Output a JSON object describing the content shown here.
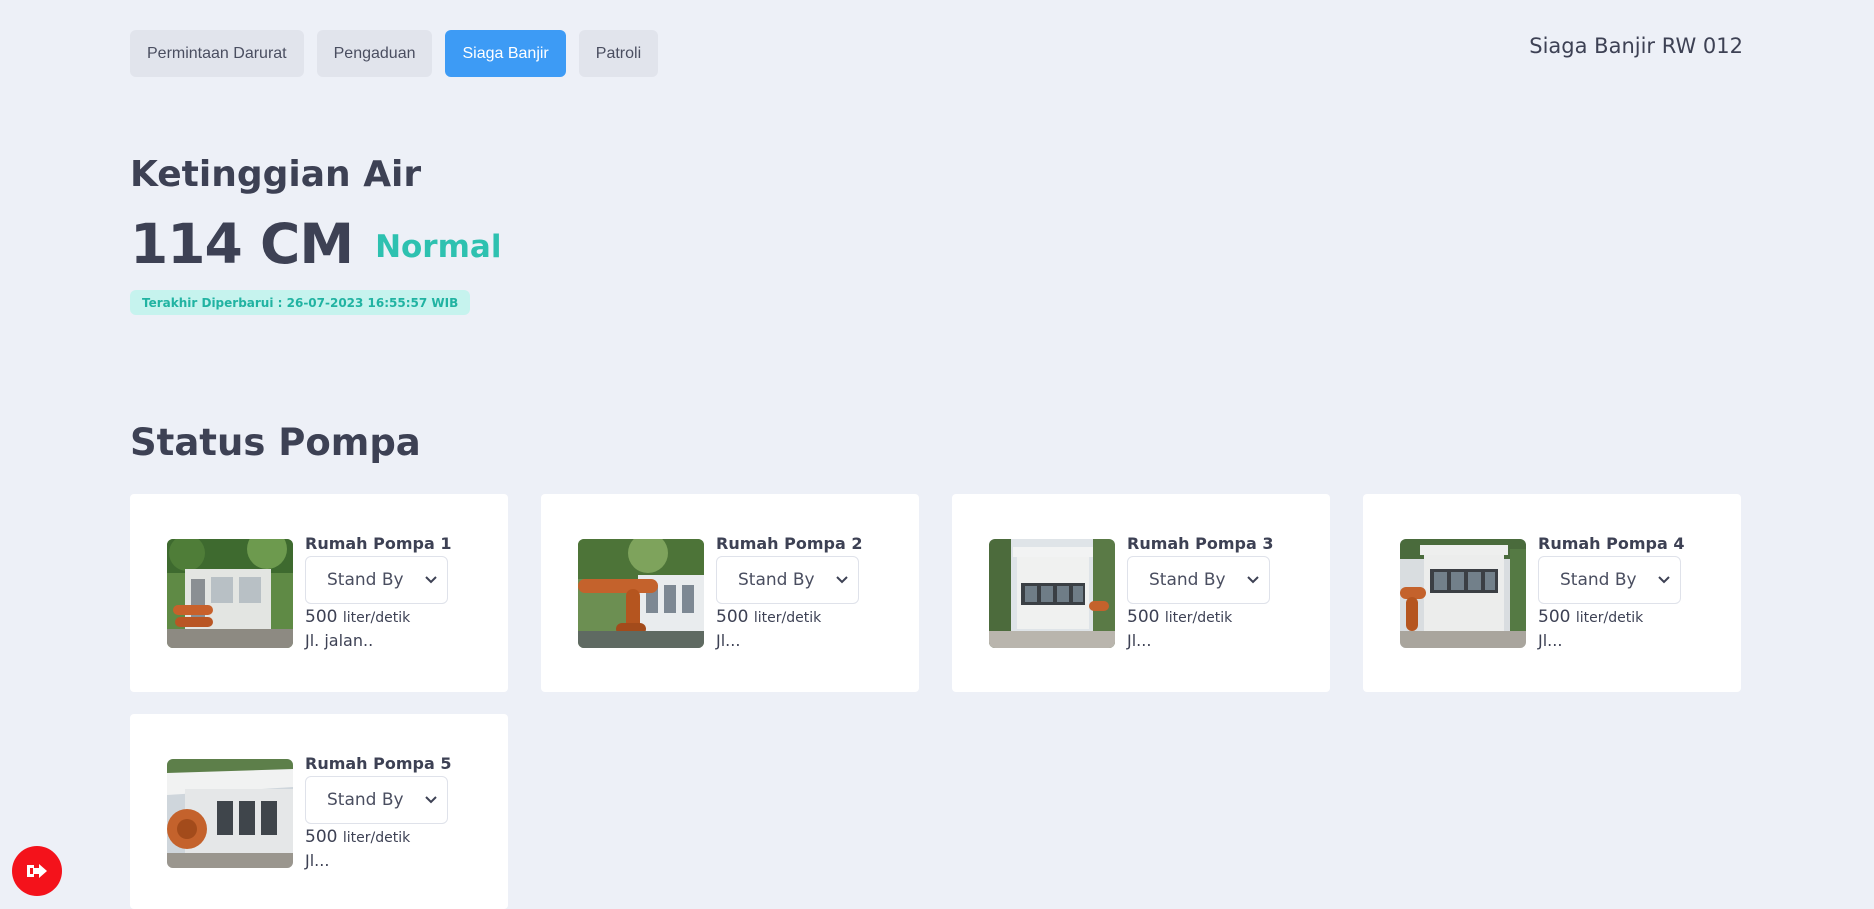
{
  "nav": {
    "tabs": [
      {
        "label": "Permintaan Darurat"
      },
      {
        "label": "Pengaduan"
      },
      {
        "label": "Siaga Banjir",
        "active": true
      },
      {
        "label": "Patroli"
      }
    ],
    "app_title": "Siaga Banjir RW 012"
  },
  "water": {
    "heading": "Ketinggian Air",
    "value": "114 CM",
    "status": "Normal",
    "updated": "Terakhir Diperbarui : 26-07-2023 16:55:57 WIB"
  },
  "pumps": {
    "heading": "Status Pompa",
    "items": [
      {
        "name": "Rumah Pompa 1",
        "status": "Stand By",
        "rate": "500",
        "unit": "liter/detik",
        "address": "Jl. jalan.."
      },
      {
        "name": "Rumah Pompa 2",
        "status": "Stand By",
        "rate": "500",
        "unit": "liter/detik",
        "address": "Jl..."
      },
      {
        "name": "Rumah Pompa 3",
        "status": "Stand By",
        "rate": "500",
        "unit": "liter/detik",
        "address": "Jl..."
      },
      {
        "name": "Rumah Pompa 4",
        "status": "Stand By",
        "rate": "500",
        "unit": "liter/detik",
        "address": "Jl..."
      },
      {
        "name": "Rumah Pompa 5",
        "status": "Stand By",
        "rate": "500",
        "unit": "liter/detik",
        "address": "Jl..."
      }
    ]
  },
  "logout": {
    "icon": "logout-icon"
  },
  "colors": {
    "primary": "#3d9bf5",
    "status_normal": "#2ec1b0",
    "badge_bg": "#c6f3ee",
    "logout": "#f4121b",
    "background": "#edf0f7"
  }
}
